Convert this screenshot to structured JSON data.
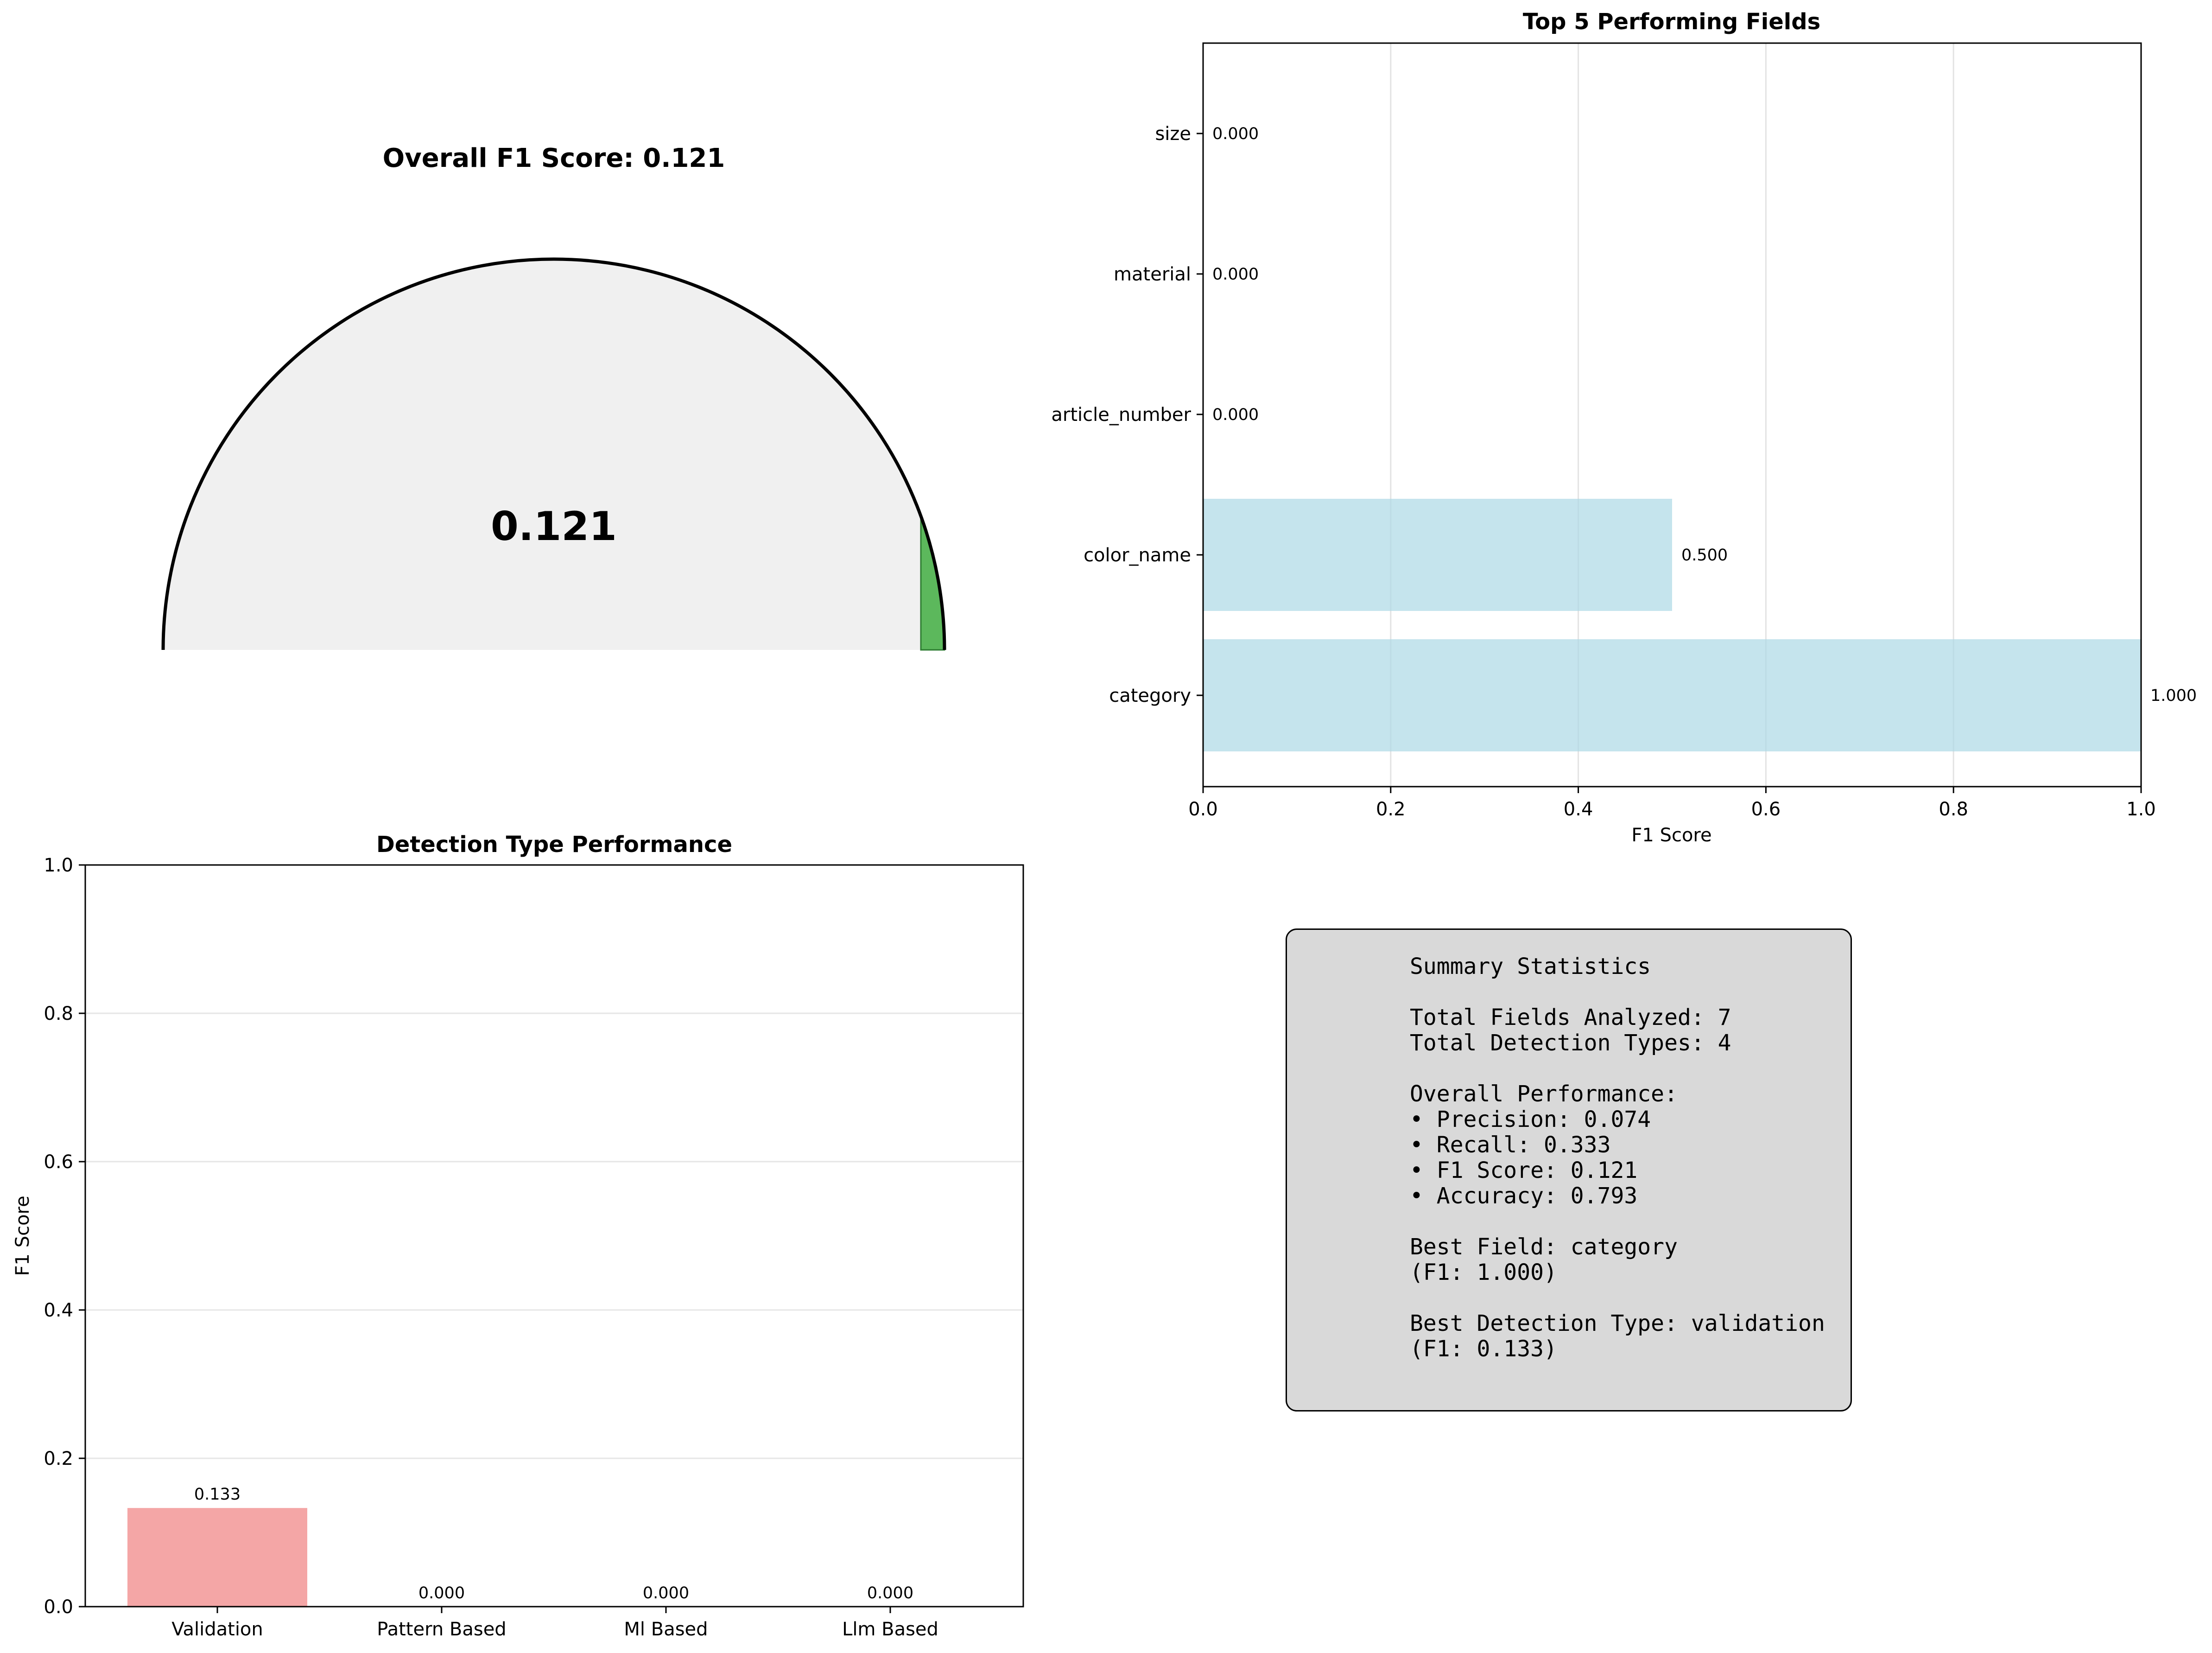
{
  "chart_data": [
    {
      "type": "gauge",
      "title": "Overall F1 Score: 0.121",
      "value": 0.121,
      "value_label": "0.121",
      "range": [
        0,
        1
      ],
      "colors": {
        "background": "#f0f0f0",
        "fill": "#5cb85c",
        "outline": "#000000"
      }
    },
    {
      "type": "bar",
      "orientation": "horizontal",
      "title": "Top 5 Performing Fields",
      "xlabel": "F1 Score",
      "ylabel": "",
      "categories": [
        "category",
        "color_name",
        "article_number",
        "material",
        "size"
      ],
      "values": [
        1.0,
        0.5,
        0.0,
        0.0,
        0.0
      ],
      "value_labels": [
        "1.000",
        "0.500",
        "0.000",
        "0.000",
        "0.000"
      ],
      "xlim": [
        0,
        1
      ],
      "x_ticks": [
        "0.0",
        "0.2",
        "0.4",
        "0.6",
        "0.8",
        "1.0"
      ],
      "grid": "x",
      "colors": {
        "bar": "#add8e6"
      }
    },
    {
      "type": "bar",
      "title": "Detection Type Performance",
      "xlabel": "",
      "ylabel": "F1 Score",
      "categories": [
        "Validation",
        "Pattern Based",
        "Ml Based",
        "Llm Based"
      ],
      "values": [
        0.133,
        0.0,
        0.0,
        0.0
      ],
      "value_labels": [
        "0.133",
        "0.000",
        "0.000",
        "0.000"
      ],
      "ylim": [
        0,
        1
      ],
      "y_ticks": [
        "0.0",
        "0.2",
        "0.4",
        "0.6",
        "0.8",
        "1.0"
      ],
      "grid": "y",
      "colors": {
        "bar": "#f08080"
      }
    }
  ],
  "summary": {
    "text": "Summary Statistics\n\nTotal Fields Analyzed: 7\nTotal Detection Types: 4\n\nOverall Performance:\n• Precision: 0.074\n• Recall: 0.333\n• F1 Score: 0.121\n• Accuracy: 0.793\n\nBest Field: category\n(F1: 1.000)\n\nBest Detection Type: validation\n(F1: 0.133)"
  }
}
